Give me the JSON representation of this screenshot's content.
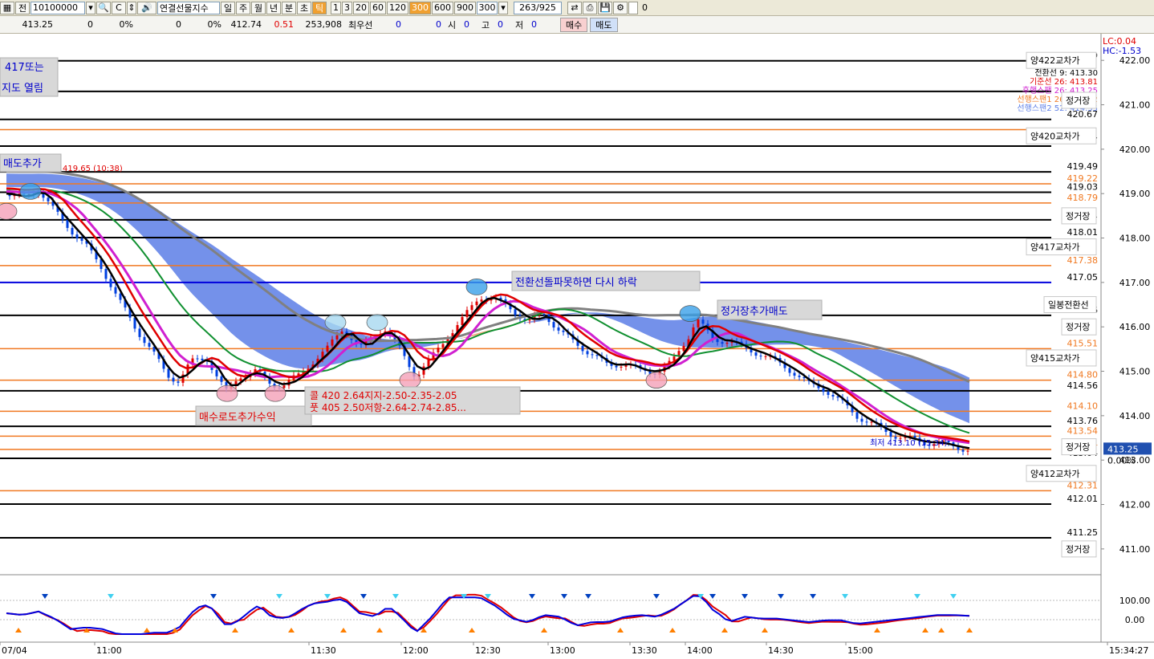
{
  "toolbar": {
    "tab_label": "전",
    "code_value": "10100000",
    "product_name": "연결선물지수",
    "periods": [
      "일",
      "주",
      "월",
      "년",
      "분",
      "초",
      "틱"
    ],
    "active_period": "틱",
    "intervals": [
      "1",
      "3",
      "20",
      "60",
      "120",
      "300",
      "600",
      "900"
    ],
    "active_interval": "300",
    "interval_select": "300",
    "count": "263/925",
    "checkbox_label": "0"
  },
  "quote": {
    "price": "413.25",
    "v1": "0",
    "p1": "0%",
    "v2": "0",
    "p2": "0%",
    "prev": "412.74",
    "change": "0.51",
    "volume": "253,908",
    "best_label": "최우선",
    "best_v1": "0",
    "best_v2": "0",
    "open_label": "시",
    "open_v": "0",
    "high_label": "고",
    "high_v": "0",
    "low_label": "저",
    "low_v": "0",
    "buy_label": "매수",
    "sell_label": "매도"
  },
  "colors": {
    "black_line": "#000000",
    "orange_line": "#f07820",
    "blue_line": "#0000dd",
    "red_ma": "#e00000",
    "magenta_ma": "#d020d0",
    "green_ma": "#109030",
    "gray_ma": "#808080",
    "cloud_blue": "#5c7ee6",
    "cloud_orange": "#f0a070"
  },
  "chart_data": {
    "type": "line",
    "ylim": [
      410.6,
      422.6
    ],
    "y_ticks": [
      "422.00",
      "421.00",
      "420.00",
      "419.00",
      "418.00",
      "417.00",
      "416.00",
      "415.00",
      "414.00",
      "413.00",
      "412.00",
      "411.00"
    ],
    "x_ticks": [
      "07/04",
      "11:00",
      "11:30",
      "12:00",
      "12:30",
      "13:00",
      "13:30",
      "14:00",
      "14:30",
      "15:00",
      "15:34:27"
    ],
    "price_path": [
      [
        0,
        419.0
      ],
      [
        20,
        418.9
      ],
      [
        40,
        419.1
      ],
      [
        60,
        418.6
      ],
      [
        80,
        418.2
      ],
      [
        100,
        417.8
      ],
      [
        120,
        417.3
      ],
      [
        140,
        416.6
      ],
      [
        160,
        416.0
      ],
      [
        180,
        415.5
      ],
      [
        200,
        414.9
      ],
      [
        215,
        414.8
      ],
      [
        230,
        415.2
      ],
      [
        250,
        415.3
      ],
      [
        265,
        414.8
      ],
      [
        275,
        414.5
      ],
      [
        290,
        414.9
      ],
      [
        310,
        415.0
      ],
      [
        330,
        414.7
      ],
      [
        345,
        414.7
      ],
      [
        365,
        414.9
      ],
      [
        380,
        415.2
      ],
      [
        400,
        415.5
      ],
      [
        420,
        416.0
      ],
      [
        440,
        415.5
      ],
      [
        460,
        415.8
      ],
      [
        470,
        416.0
      ],
      [
        490,
        415.5
      ],
      [
        510,
        414.9
      ],
      [
        530,
        415.3
      ],
      [
        550,
        415.8
      ],
      [
        570,
        416.2
      ],
      [
        590,
        416.7
      ],
      [
        610,
        416.6
      ],
      [
        630,
        416.4
      ],
      [
        650,
        416.1
      ],
      [
        670,
        416.3
      ],
      [
        690,
        415.9
      ],
      [
        710,
        415.6
      ],
      [
        730,
        415.4
      ],
      [
        750,
        415.1
      ],
      [
        770,
        415.2
      ],
      [
        790,
        415.0
      ],
      [
        810,
        415.0
      ],
      [
        830,
        415.2
      ],
      [
        850,
        415.8
      ],
      [
        860,
        416.2
      ],
      [
        880,
        415.7
      ],
      [
        900,
        415.7
      ],
      [
        920,
        415.5
      ],
      [
        940,
        415.4
      ],
      [
        960,
        415.2
      ],
      [
        980,
        415.0
      ],
      [
        1000,
        414.7
      ],
      [
        1020,
        414.6
      ],
      [
        1040,
        414.3
      ],
      [
        1060,
        414.0
      ],
      [
        1080,
        413.8
      ],
      [
        1100,
        413.6
      ],
      [
        1120,
        413.5
      ],
      [
        1140,
        413.4
      ],
      [
        1160,
        413.4
      ],
      [
        1180,
        413.3
      ],
      [
        1200,
        413.25
      ]
    ],
    "h_lines_black": [
      {
        "value": 421.99,
        "label": "421.99"
      },
      {
        "value": 421.3,
        "label": ""
      },
      {
        "value": 420.67,
        "label": "420.67"
      },
      {
        "value": 420.07,
        "label": "420.07"
      },
      {
        "value": 419.49,
        "label": "419.49"
      },
      {
        "value": 419.03,
        "label": "419.03"
      },
      {
        "value": 418.41,
        "label": "418.41"
      },
      {
        "value": 418.01,
        "label": "418.01"
      },
      {
        "value": 416.26,
        "label": "416.26"
      },
      {
        "value": 414.56,
        "label": "414.56"
      },
      {
        "value": 413.76,
        "label": "413.76"
      },
      {
        "value": 413.04,
        "label": "413.04"
      },
      {
        "value": 412.01,
        "label": "412.01"
      },
      {
        "value": 411.25,
        "label": "411.25"
      }
    ],
    "h_lines_orange": [
      {
        "value": 420.44,
        "label": ""
      },
      {
        "value": 419.22,
        "label": "419.22"
      },
      {
        "value": 418.79,
        "label": "418.79"
      },
      {
        "value": 417.38,
        "label": "417.38"
      },
      {
        "value": 415.51,
        "label": "415.51"
      },
      {
        "value": 414.8,
        "label": "414.80"
      },
      {
        "value": 414.1,
        "label": "414.10"
      },
      {
        "value": 413.54,
        "label": "413.54"
      },
      {
        "value": 413.24,
        "label": "413.24"
      },
      {
        "value": 412.31,
        "label": "412.31"
      }
    ],
    "h_lines_blue": [
      {
        "value": 417.0,
        "label": "417.05"
      }
    ],
    "right_labels": [
      {
        "text": "양422교차가",
        "value": 422.0
      },
      {
        "text": "정거장",
        "value": 421.1
      },
      {
        "text": "양420교차가",
        "value": 420.3
      },
      {
        "text": "정거장",
        "value": 418.5
      },
      {
        "text": "양417교차가",
        "value": 417.8
      },
      {
        "text": "일봉전환선",
        "value": 416.5
      },
      {
        "text": "정거장",
        "value": 416.0
      },
      {
        "text": "양415교차가",
        "value": 415.3
      },
      {
        "text": "정거장",
        "value": 413.3
      },
      {
        "text": "양412교차가",
        "value": 412.7
      },
      {
        "text": "정거장",
        "value": 411.0
      }
    ],
    "legend": [
      {
        "text": "전환선 9: 413.30",
        "color": "#000000"
      },
      {
        "text": "기준선 26: 413.81",
        "color": "#e00000"
      },
      {
        "text": "후행스팬 26: 413.25",
        "color": "#d020d0"
      },
      {
        "text": "선행스팬1 26: 413.42",
        "color": "#f07820"
      },
      {
        "text": "선행스팬2 52: 414.35",
        "color": "#5c7ee6"
      }
    ],
    "lc_hc": [
      "LC:0.04",
      "HC:-1.53"
    ],
    "current_price_tag": "413.25",
    "pct_tag": "0.00%",
    "low_marker": "최저 413.10 (15:34)",
    "high_marker": "419.65 (10:38)",
    "annotations": [
      {
        "text": "417또는",
        "sub": "지도 열림"
      },
      {
        "text": "매도추가"
      },
      {
        "text": "전환선돌파못하면 다시 하락"
      },
      {
        "text": "정거장추가매도"
      },
      {
        "text": "매수로도추가수익"
      },
      {
        "text": "콜 420 2.64지지-2.50-2.35-2.05"
      },
      {
        "text": "풋 405 2.50저항-2.64-2.74-2.85..."
      }
    ],
    "osc_ticks": [
      "100.00",
      "0.00"
    ]
  }
}
